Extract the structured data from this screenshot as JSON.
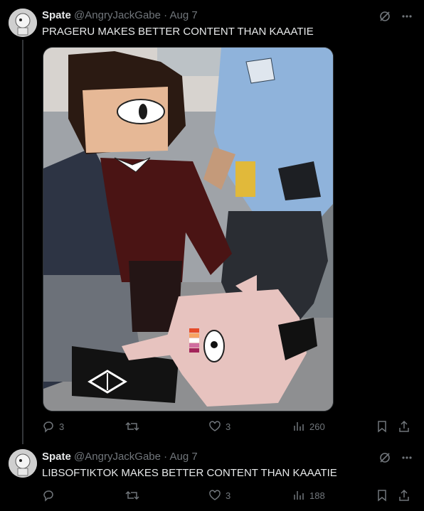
{
  "tweets": [
    {
      "name": "Spate",
      "handle": "@AngryJackGabe",
      "sep": "·",
      "date": "Aug 7",
      "text": "PRAGERU MAKES BETTER CONTENT THAN KAAATIE",
      "replies": "3",
      "retweets": "",
      "likes": "3",
      "views": "260"
    },
    {
      "name": "Spate",
      "handle": "@AngryJackGabe",
      "sep": "·",
      "date": "Aug 7",
      "text": "LIBSOFTIKTOK MAKES BETTER CONTENT THAN KAAATIE",
      "replies": "",
      "retweets": "",
      "likes": "3",
      "views": "188"
    }
  ],
  "icons": [
    "avatar",
    "grok-icon",
    "more-icon",
    "reply-icon",
    "retweet-icon",
    "like-icon",
    "views-icon",
    "bookmark-icon",
    "share-icon"
  ],
  "colors": {
    "background": "#000000",
    "text": "#e7e9ea",
    "muted": "#71767b",
    "thread_line": "#333639"
  }
}
